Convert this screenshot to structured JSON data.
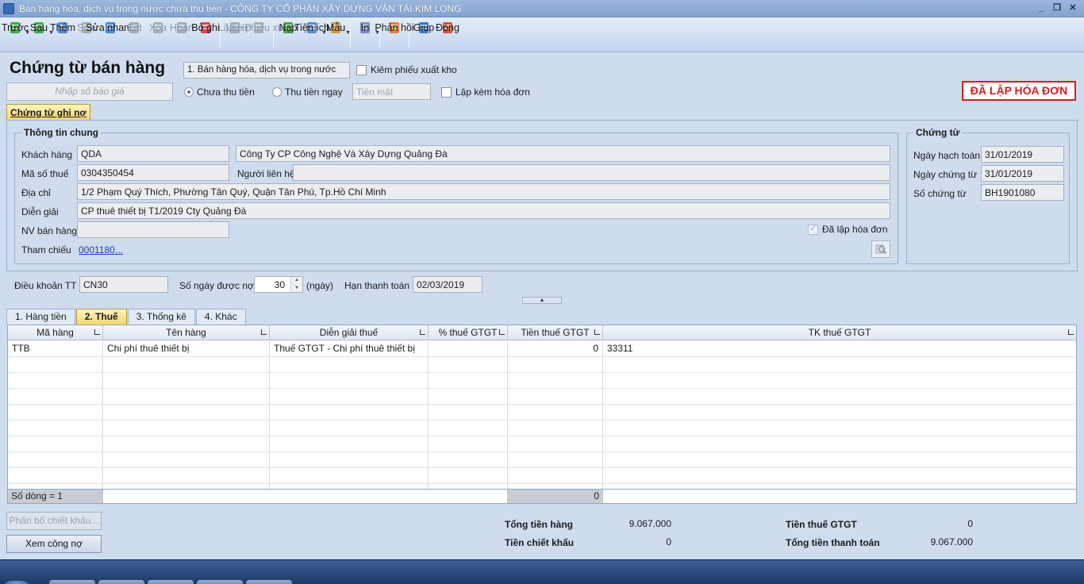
{
  "window": {
    "title": "Bán hàng hóa, dịch vụ trong nước chưa thu tiền - CÔNG TY CỔ PHẦN XÂY DỰNG VẬN TẢI KIM LONG"
  },
  "toolbar": {
    "items": [
      {
        "label": "Trước",
        "icon": "arrow-left-icon",
        "color": "#2e9a2e",
        "enabled": true,
        "drop": true
      },
      {
        "label": "Sau",
        "icon": "arrow-right-icon",
        "color": "#2e9a2e",
        "enabled": true,
        "drop": true
      },
      {
        "label": "Thêm",
        "icon": "add-document-icon",
        "color": "#3a78c8",
        "enabled": true
      },
      {
        "label": "Sửa",
        "icon": "edit-document-icon",
        "color": "#9aa4b0",
        "enabled": false
      },
      {
        "label": "Sửa nhanh",
        "icon": "quick-edit-icon",
        "color": "#3a78c8",
        "enabled": true
      },
      {
        "label": "Cất",
        "icon": "save-icon",
        "color": "#9aa4b0",
        "enabled": false
      },
      {
        "label": "Xóa",
        "icon": "delete-icon",
        "color": "#9aa4b0",
        "enabled": false
      },
      {
        "label": "Hoãn",
        "icon": "undo-icon",
        "color": "#9aa4b0",
        "enabled": false
      },
      {
        "label": "Bỏ ghi",
        "icon": "unpost-icon",
        "color": "#d43030",
        "enabled": true
      },
      {
        "label": "Lập HĐ",
        "icon": "invoice-icon",
        "color": "#9aa4b0",
        "enabled": false
      },
      {
        "label": "Lập phiếu xuất",
        "icon": "issue-slip-icon",
        "color": "#9aa4b0",
        "enabled": false
      },
      {
        "label": "Nạp",
        "icon": "reload-icon",
        "color": "#2e9a2e",
        "enabled": true
      },
      {
        "label": "Tiện ích",
        "icon": "utilities-icon",
        "color": "#4a7ab8",
        "enabled": true,
        "drop": true
      },
      {
        "label": "Mẫu",
        "icon": "template-icon",
        "color": "#d98a20",
        "enabled": true,
        "drop": true
      },
      {
        "label": "In",
        "icon": "printer-icon",
        "color": "#6a7ab8",
        "enabled": true,
        "drop": true
      },
      {
        "label": "Phản hồi",
        "icon": "feedback-mail-icon",
        "color": "#e07020",
        "enabled": true
      },
      {
        "label": "Giúp",
        "icon": "help-icon",
        "color": "#2a6cc8",
        "enabled": true
      },
      {
        "label": "Đóng",
        "icon": "close-door-icon",
        "color": "#d04020",
        "enabled": true
      }
    ]
  },
  "header": {
    "title": "Chứng từ bán hàng",
    "type_value": "1. Bán hàng hóa, dịch vụ trong nước",
    "kiem_phieu_xuat_kho": "Kiêm phiếu xuất kho",
    "quote_placeholder": "Nhập số báo giá",
    "radio_chua_thu_tien": "Chưa thu tiền",
    "radio_thu_tien_ngay": "Thu tiền ngay",
    "payment_method_placeholder": "Tiền mặt",
    "lap_kem_hoa_don": "Lập kèm hóa đơn",
    "invoiced_badge": "ĐÃ LẬP HÓA ĐƠN",
    "badge_color": "#d02020"
  },
  "main_tab": {
    "label": "Chứng từ ghi nợ"
  },
  "general_info": {
    "title": "Thông tin chung",
    "customer_label": "Khách hàng",
    "customer_code": "QDA",
    "customer_name": "Công Ty CP Công Nghệ Và Xây Dựng Quảng Đà",
    "tax_code_label": "Mã số thuế",
    "tax_code": "0304350454",
    "contact_label": "Người liên hệ",
    "contact": "",
    "address_label": "Địa chỉ",
    "address": "1/2 Phạm Quý Thích, Phường Tân Quý, Quận Tân Phú, Tp.Hồ Chí Minh",
    "description_label": "Diễn giải",
    "description": "CP thuê thiết bị T1/2019 Cty Quảng Đà",
    "salesperson_label": "NV bán hàng",
    "salesperson": "",
    "invoiced_checkbox": "Đã lập hóa đơn",
    "reference_label": "Tham chiếu",
    "reference_value": "0001180",
    "reference_more": "..."
  },
  "voucher": {
    "title": "Chứng từ",
    "posting_date_label": "Ngày hạch toán",
    "posting_date": "31/01/2019",
    "voucher_date_label": "Ngày chứng từ",
    "voucher_date": "31/01/2019",
    "voucher_no_label": "Số chứng từ",
    "voucher_no": "BH1901080"
  },
  "terms": {
    "term_label": "Điều khoản TT",
    "term_value": "CN30",
    "days_label": "Số ngày được nợ",
    "days_value": "30",
    "days_unit": "(ngày)",
    "due_label": "Hạn thanh toán",
    "due_value": "02/03/2019"
  },
  "detail_tabs": [
    {
      "label": "1. Hàng tiền",
      "active": false
    },
    {
      "label": "2. Thuế",
      "active": true
    },
    {
      "label": "3. Thống kê",
      "active": false
    },
    {
      "label": "4. Khác",
      "active": false
    }
  ],
  "grid": {
    "columns": [
      "Mã hàng",
      "Tên hàng",
      "Diễn giải thuế",
      "% thuế GTGT",
      "Tiền thuế GTGT",
      "TK thuế GTGT"
    ],
    "rows": [
      [
        "TTB",
        "Chi phí thuê thiết bị",
        "Thuế GTGT - Chi phí thuê thiết bị",
        "",
        "0",
        "33311"
      ]
    ],
    "row_count_text": "Số dòng = 1",
    "footer_tax_total": "0"
  },
  "footer": {
    "allocate_discount_btn": "Phân bổ chiết khấu...",
    "view_debt_btn": "Xem công nợ",
    "total_goods_label": "Tổng tiền hàng",
    "total_goods": "9.067.000",
    "discount_label": "Tiền chiết khấu",
    "discount": "0",
    "vat_label": "Tiền thuế GTGT",
    "vat": "0",
    "total_payment_label": "Tổng tiền thanh toán",
    "total_payment": "9.067.000"
  }
}
